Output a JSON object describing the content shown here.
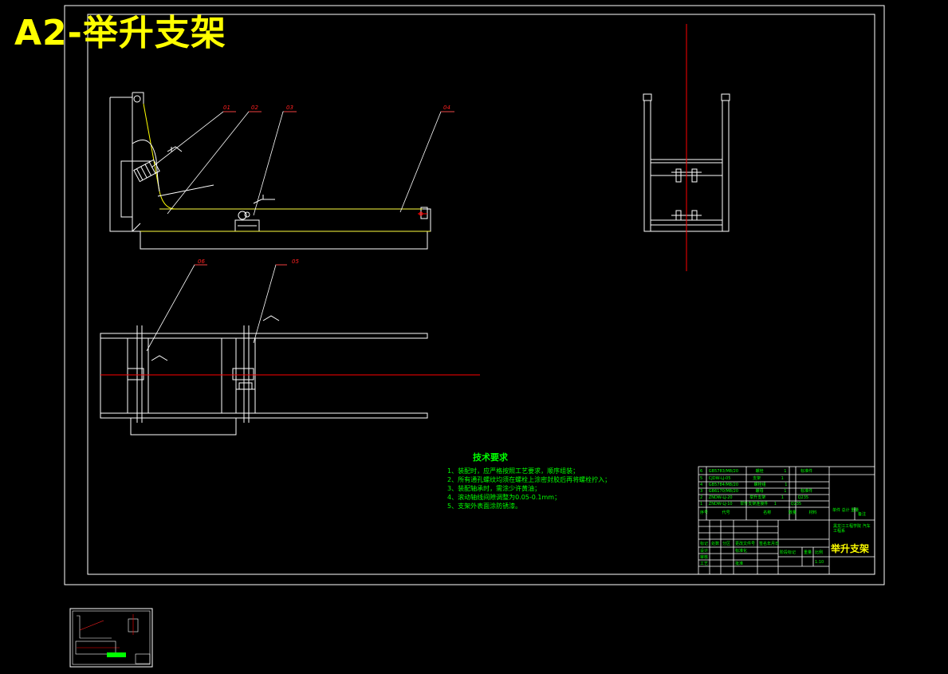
{
  "drawing": {
    "title": "A2-举升支架",
    "part_labels": [
      "01",
      "02",
      "03",
      "04",
      "05",
      "06"
    ]
  },
  "tech_requirements": {
    "title": "技术要求",
    "lines": [
      "1、装配时，应严格按照工艺要求，顺序组装；",
      "2、所有通孔螺纹均须在螺栓上涂密封胶后再将螺栓拧入；",
      "3、装配轴承时，需涂少许黄油；",
      "4、滚动轴线间隙调整为0.05-0.1mm；",
      "5、支架外表面涂防锈漆。"
    ]
  },
  "bom": {
    "rows": [
      {
        "no": "6",
        "code": "GB5783/M8/20",
        "name": "螺栓",
        "qty": "1",
        "material": "标准件"
      },
      {
        "no": "5",
        "code": "CJDW-LJ-05",
        "name": "支架",
        "qty": "1",
        "material": ""
      },
      {
        "no": "4",
        "code": "GB5784/M8/20",
        "name": "螺栓组",
        "qty": "1",
        "material": ""
      },
      {
        "no": "3",
        "code": "GB6170/M8/20",
        "name": "螺母",
        "qty": "1",
        "material": "标准件"
      },
      {
        "no": "2",
        "code": "ZNDW-LJ-20",
        "name": "举升支架",
        "qty": "1",
        "material": "Q235"
      },
      {
        "no": "1",
        "code": "ZNDW-LJ-10",
        "name": "举升支架连接件",
        "qty": "1",
        "material": "Q235"
      }
    ],
    "header": [
      "序号",
      "代号",
      "名称",
      "数量",
      "材料",
      "单件 总计 重量",
      "备注"
    ]
  },
  "title_block": {
    "drawing_name": "举升支架",
    "company": "黑龙江工程学院 汽车工程系",
    "scale": "1:10",
    "labels": [
      "标记",
      "处数",
      "分区",
      "更改文件号",
      "签名",
      "年月日",
      "设计",
      "标准化",
      "审核",
      "工艺",
      "批准",
      "阶段标记",
      "重量",
      "比例"
    ]
  },
  "colors": {
    "background": "#000000",
    "frame": "#ffffff",
    "part_lines": "#ffffff",
    "center_line": "#ff0000",
    "leader_line": "#ffff00",
    "text": "#00ff00",
    "title": "#ffff00"
  }
}
